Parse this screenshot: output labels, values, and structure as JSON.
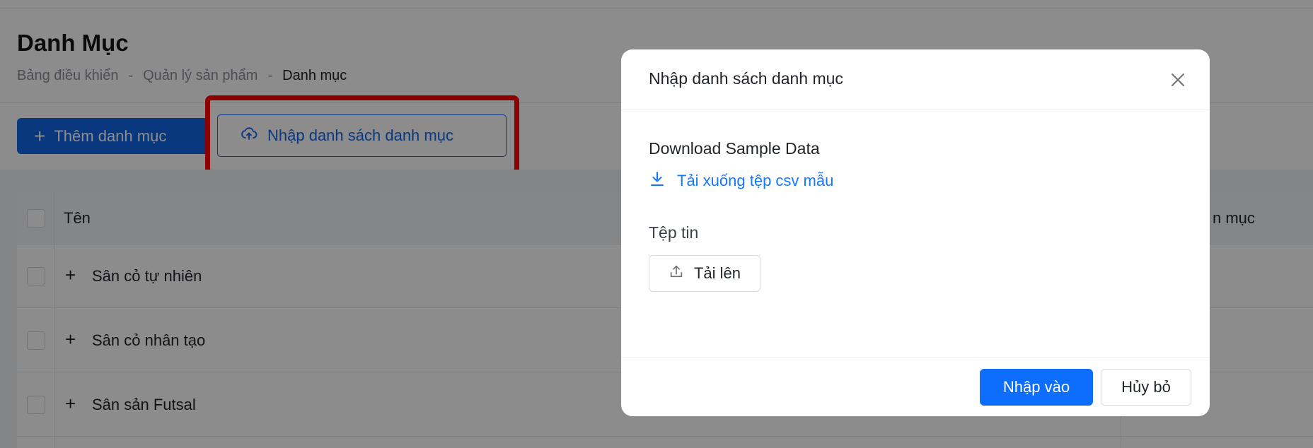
{
  "page": {
    "title": "Danh Mục",
    "breadcrumb": [
      "Bảng điều khiển",
      "-",
      "Quản lý sản phẩm",
      "-",
      "Danh mục"
    ]
  },
  "toolbar": {
    "add_label": "Thêm danh mục",
    "import_label": "Nhập danh sách danh mục"
  },
  "table": {
    "columns": [
      "Tên",
      "n mục"
    ],
    "rows": [
      {
        "name": "Sân cỏ tự nhiên"
      },
      {
        "name": "Sân cỏ nhân tạo"
      },
      {
        "name": "Sân sản Futsal"
      }
    ]
  },
  "modal": {
    "title": "Nhập danh sách danh mục",
    "sample_label": "Download Sample Data",
    "download_link": "Tải xuống tệp csv mẫu",
    "file_label": "Tệp tin",
    "upload_label": "Tải lên",
    "submit_label": "Nhập vào",
    "cancel_label": "Hủy bỏ"
  },
  "colors": {
    "primary": "#1366e8",
    "highlight": "#ff0000",
    "link": "#1677ff"
  },
  "icons": [
    "plus-icon",
    "cloud-upload-icon",
    "close-icon",
    "download-icon",
    "upload-icon"
  ]
}
